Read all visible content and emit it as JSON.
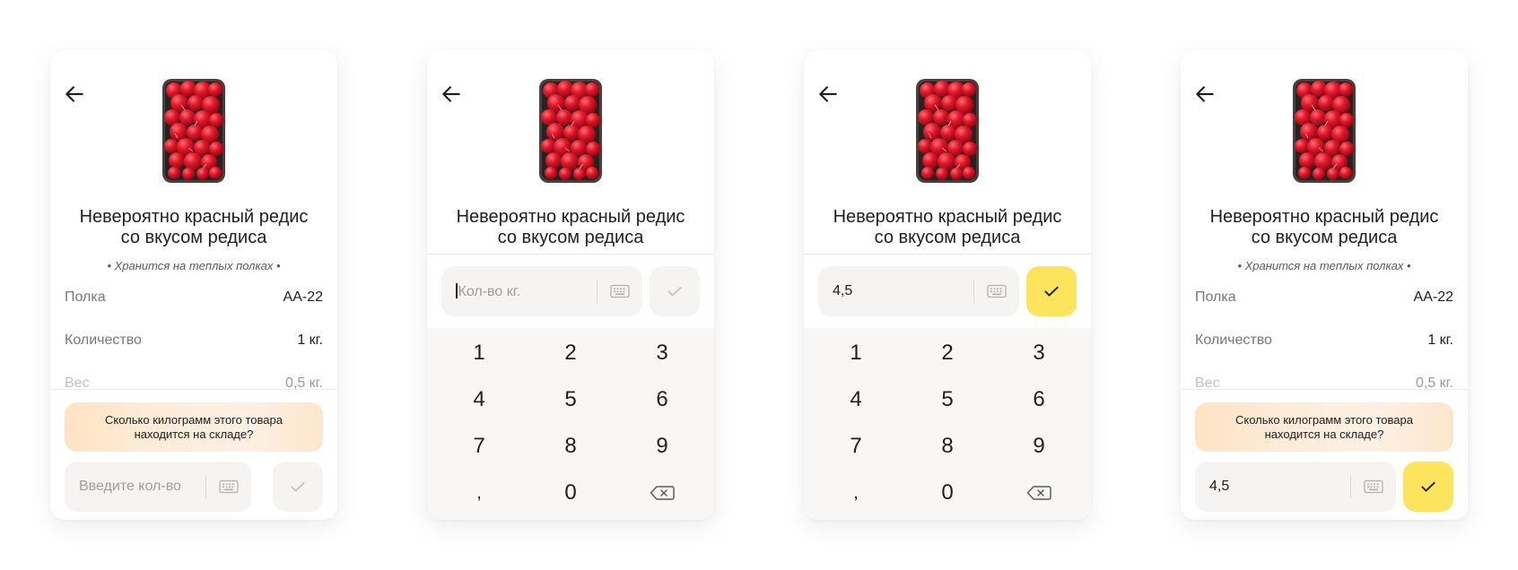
{
  "product": {
    "title_line1": "Невероятно красный редис",
    "title_line2": "со вкусом редиса",
    "storage_note": "• Хранится на теплых полках •"
  },
  "details": [
    {
      "label": "Полка",
      "value": "АА-22"
    },
    {
      "label": "Количество",
      "value": "1 кг."
    },
    {
      "label": "Вес",
      "value": "0,5 кг."
    }
  ],
  "prompt": {
    "line1": "Сколько килограмм этого товара",
    "line2": "находится на складе?"
  },
  "screens": {
    "s1": {
      "input_placeholder": "Введите кол-во",
      "input_value": ""
    },
    "s2": {
      "input_placeholder": "Кол-во кг.",
      "input_value": ""
    },
    "s3": {
      "input_placeholder": "",
      "input_value": "4,5"
    },
    "s4": {
      "input_placeholder": "",
      "input_value": "4,5"
    }
  },
  "keypad": {
    "keys": [
      "1",
      "2",
      "3",
      "4",
      "5",
      "6",
      "7",
      "8",
      "9",
      ",",
      "0"
    ],
    "backspace_icon": "backspace-icon"
  },
  "icons": {
    "back": "arrow-left-icon",
    "keyboard": "keyboard-icon",
    "confirm": "checkmark-icon"
  },
  "colors": {
    "accent": "#fce45d",
    "prompt_bg": "#fde6cc",
    "input_bg": "#f5f4f2",
    "text": "#21201f",
    "muted": "#7a7773"
  }
}
